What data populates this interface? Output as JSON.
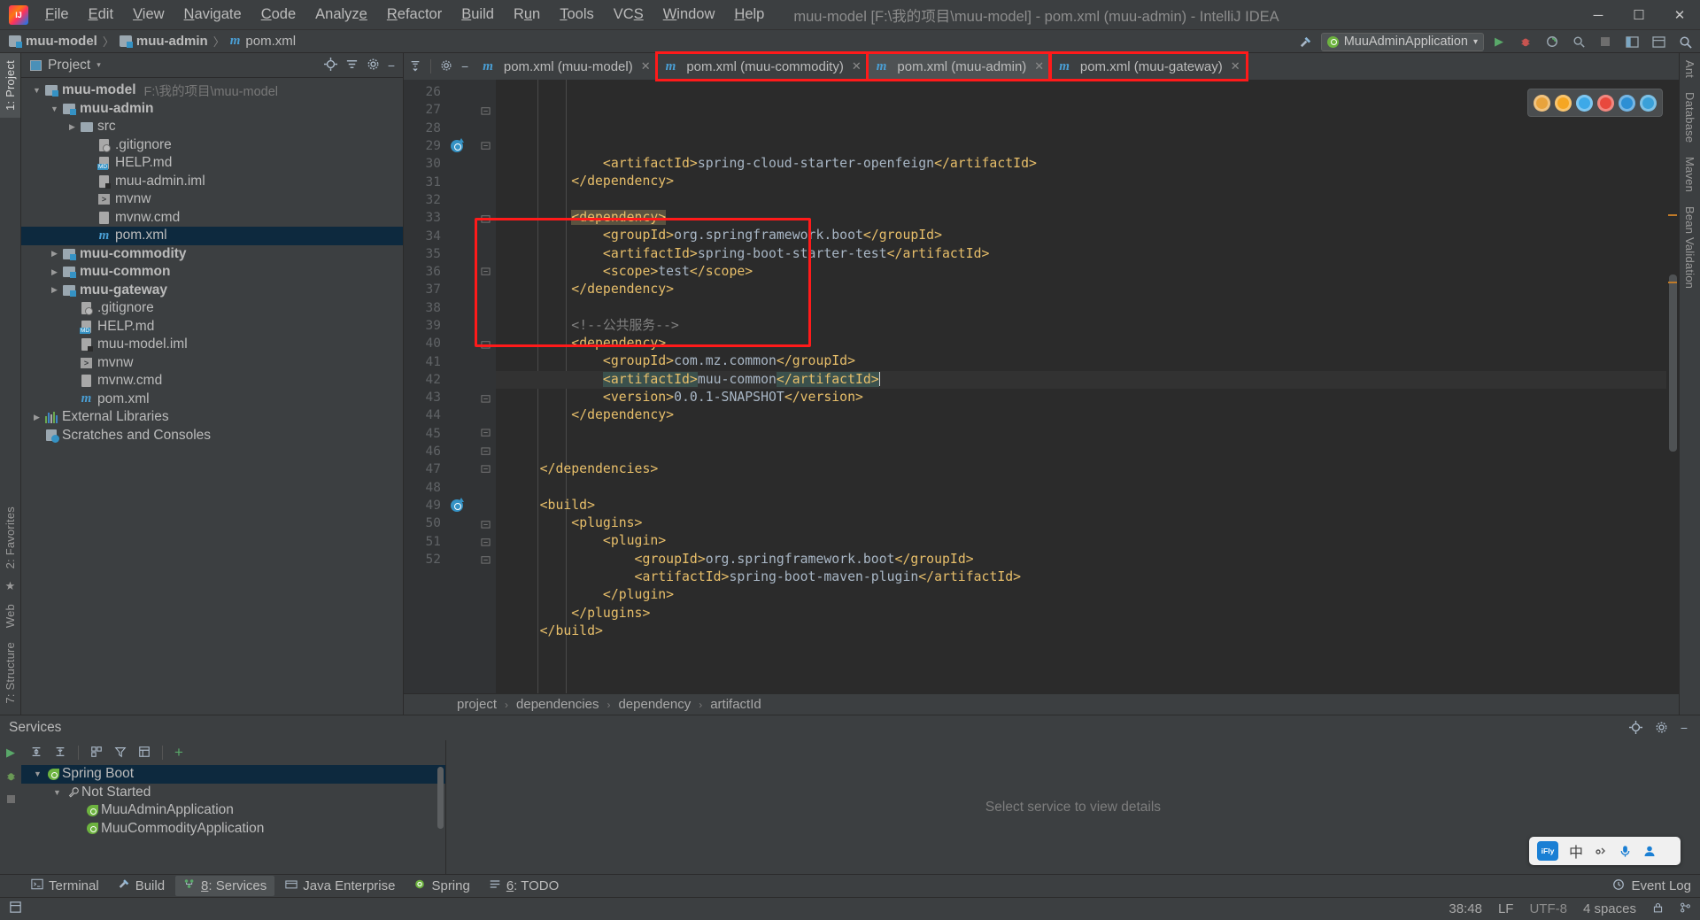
{
  "window": {
    "title": "muu-model [F:\\我的项目\\muu-model] - pom.xml (muu-admin) - IntelliJ IDEA",
    "minimize": "─",
    "maximize": "☐",
    "close": "✕"
  },
  "menubar": [
    {
      "label": "File"
    },
    {
      "label": "Edit"
    },
    {
      "label": "View"
    },
    {
      "label": "Navigate"
    },
    {
      "label": "Code"
    },
    {
      "label": "Analyze"
    },
    {
      "label": "Refactor"
    },
    {
      "label": "Build"
    },
    {
      "label": "Run"
    },
    {
      "label": "Tools"
    },
    {
      "label": "VCS"
    },
    {
      "label": "Window"
    },
    {
      "label": "Help"
    }
  ],
  "breadcrumb_nav": {
    "items": [
      "muu-model",
      "muu-admin",
      "pom.xml"
    ],
    "separator": "〉"
  },
  "run_config": {
    "name": "MuuAdminApplication",
    "dropdown_arrow": "▾",
    "run_icon": "play-icon",
    "debug_icon": "debug-icon",
    "coverage_icon": "run-with-coverage-icon",
    "profile_icon": "profiler-icon",
    "stop_icon": "stop-icon",
    "hammer_icon": "build-icon",
    "layout_icon": "layout-icon",
    "search_icon": "search-icon"
  },
  "project_panel": {
    "title": "Project",
    "dropdown_arrow": "▾",
    "locate_icon": "locate-file-icon",
    "collapse_icon": "collapse-all-icon",
    "settings_icon": "gear-icon",
    "hide_icon": "hide-panel-icon",
    "tree": [
      {
        "label": "muu-model",
        "hint": "F:\\我的项目\\muu-model",
        "indent": 0,
        "arrow": "open",
        "icon": "module",
        "bold": true,
        "selected": false
      },
      {
        "label": "muu-admin",
        "hint": "",
        "indent": 1,
        "arrow": "open",
        "icon": "module",
        "bold": true,
        "selected": false
      },
      {
        "label": "src",
        "hint": "",
        "indent": 2,
        "arrow": "closed",
        "icon": "folder",
        "bold": false,
        "selected": false
      },
      {
        "label": ".gitignore",
        "hint": "",
        "indent": 3,
        "arrow": "none",
        "icon": "git",
        "bold": false,
        "selected": false
      },
      {
        "label": "HELP.md",
        "hint": "",
        "indent": 3,
        "arrow": "none",
        "icon": "md",
        "bold": false,
        "selected": false
      },
      {
        "label": "muu-admin.iml",
        "hint": "",
        "indent": 3,
        "arrow": "none",
        "icon": "iml",
        "bold": false,
        "selected": false
      },
      {
        "label": "mvnw",
        "hint": "",
        "indent": 3,
        "arrow": "none",
        "icon": "sh",
        "bold": false,
        "selected": false
      },
      {
        "label": "mvnw.cmd",
        "hint": "",
        "indent": 3,
        "arrow": "none",
        "icon": "file",
        "bold": false,
        "selected": false
      },
      {
        "label": "pom.xml",
        "hint": "",
        "indent": 3,
        "arrow": "none",
        "icon": "maven",
        "bold": false,
        "selected": true
      },
      {
        "label": "muu-commodity",
        "hint": "",
        "indent": 1,
        "arrow": "closed",
        "icon": "module",
        "bold": true,
        "selected": false
      },
      {
        "label": "muu-common",
        "hint": "",
        "indent": 1,
        "arrow": "closed",
        "icon": "module",
        "bold": true,
        "selected": false
      },
      {
        "label": "muu-gateway",
        "hint": "",
        "indent": 1,
        "arrow": "closed",
        "icon": "module",
        "bold": true,
        "selected": false
      },
      {
        "label": ".gitignore",
        "hint": "",
        "indent": 2,
        "arrow": "none",
        "icon": "git",
        "bold": false,
        "selected": false
      },
      {
        "label": "HELP.md",
        "hint": "",
        "indent": 2,
        "arrow": "none",
        "icon": "md",
        "bold": false,
        "selected": false
      },
      {
        "label": "muu-model.iml",
        "hint": "",
        "indent": 2,
        "arrow": "none",
        "icon": "iml",
        "bold": false,
        "selected": false
      },
      {
        "label": "mvnw",
        "hint": "",
        "indent": 2,
        "arrow": "none",
        "icon": "sh",
        "bold": false,
        "selected": false
      },
      {
        "label": "mvnw.cmd",
        "hint": "",
        "indent": 2,
        "arrow": "none",
        "icon": "file",
        "bold": false,
        "selected": false
      },
      {
        "label": "pom.xml",
        "hint": "",
        "indent": 2,
        "arrow": "none",
        "icon": "maven",
        "bold": false,
        "selected": false
      },
      {
        "label": "External Libraries",
        "hint": "",
        "indent": 0,
        "arrow": "closed",
        "icon": "lib",
        "bold": false,
        "selected": false
      },
      {
        "label": "Scratches and Consoles",
        "hint": "",
        "indent": 0,
        "arrow": "none",
        "icon": "scratch",
        "bold": false,
        "selected": false
      }
    ]
  },
  "editor_tabs": [
    {
      "label": "pom.xml (muu-model)",
      "active": false,
      "highlighted": false,
      "close": "✕"
    },
    {
      "label": "pom.xml (muu-commodity)",
      "active": false,
      "highlighted": true,
      "close": "✕"
    },
    {
      "label": "pom.xml (muu-admin)",
      "active": true,
      "highlighted": true,
      "close": "✕"
    },
    {
      "label": "pom.xml (muu-gateway)",
      "active": false,
      "highlighted": true,
      "close": "✕"
    }
  ],
  "editor": {
    "first_line": 26,
    "caret_position": "38:48",
    "lines": [
      {
        "num": 26,
        "indent": 3,
        "segments": [
          {
            "t": "<artifactId>",
            "c": "tag"
          },
          {
            "t": "spring-cloud-starter-openfeign",
            "c": "txt"
          },
          {
            "t": "</artifactId>",
            "c": "tag"
          }
        ],
        "fold": "",
        "gutter_icon": ""
      },
      {
        "num": 27,
        "indent": 2,
        "segments": [
          {
            "t": "</dependency>",
            "c": "tag"
          }
        ],
        "fold": "end",
        "gutter_icon": ""
      },
      {
        "num": 28,
        "indent": 0,
        "segments": [],
        "fold": "",
        "gutter_icon": ""
      },
      {
        "num": 29,
        "indent": 2,
        "segments": [
          {
            "t": "<dependency>",
            "c": "tag hl-tag"
          }
        ],
        "fold": "start",
        "gutter_icon": "run"
      },
      {
        "num": 30,
        "indent": 3,
        "segments": [
          {
            "t": "<groupId>",
            "c": "tag"
          },
          {
            "t": "org.springframework.boot",
            "c": "txt"
          },
          {
            "t": "</groupId>",
            "c": "tag"
          }
        ],
        "fold": "",
        "gutter_icon": ""
      },
      {
        "num": 31,
        "indent": 3,
        "segments": [
          {
            "t": "<artifactId>",
            "c": "tag"
          },
          {
            "t": "spring-boot-starter-test",
            "c": "txt"
          },
          {
            "t": "</artifactId>",
            "c": "tag"
          }
        ],
        "fold": "",
        "gutter_icon": ""
      },
      {
        "num": 32,
        "indent": 3,
        "segments": [
          {
            "t": "<scope>",
            "c": "tag"
          },
          {
            "t": "test",
            "c": "txt"
          },
          {
            "t": "</scope>",
            "c": "tag"
          }
        ],
        "fold": "",
        "gutter_icon": ""
      },
      {
        "num": 33,
        "indent": 2,
        "segments": [
          {
            "t": "</dependency>",
            "c": "tag"
          }
        ],
        "fold": "end",
        "gutter_icon": ""
      },
      {
        "num": 34,
        "indent": 0,
        "segments": [],
        "fold": "",
        "gutter_icon": ""
      },
      {
        "num": 35,
        "indent": 2,
        "segments": [
          {
            "t": "<!--公共服务-->",
            "c": "cmt"
          }
        ],
        "fold": "",
        "gutter_icon": ""
      },
      {
        "num": 36,
        "indent": 2,
        "segments": [
          {
            "t": "<dependency>",
            "c": "tag"
          }
        ],
        "fold": "start",
        "gutter_icon": ""
      },
      {
        "num": 37,
        "indent": 3,
        "segments": [
          {
            "t": "<groupId>",
            "c": "tag"
          },
          {
            "t": "com.mz.common",
            "c": "txt"
          },
          {
            "t": "</groupId>",
            "c": "tag"
          }
        ],
        "fold": "",
        "gutter_icon": ""
      },
      {
        "num": 38,
        "indent": 3,
        "segments": [
          {
            "t": "<artifactId>",
            "c": "tag sel-green"
          },
          {
            "t": "muu-common",
            "c": "txt"
          },
          {
            "t": "</artifactId>",
            "c": "tag sel-green"
          }
        ],
        "fold": "",
        "gutter_icon": "",
        "current": true,
        "caret": true
      },
      {
        "num": 39,
        "indent": 3,
        "segments": [
          {
            "t": "<version>",
            "c": "tag"
          },
          {
            "t": "0.0.1-SNAPSHOT",
            "c": "txt"
          },
          {
            "t": "</version>",
            "c": "tag"
          }
        ],
        "fold": "",
        "gutter_icon": ""
      },
      {
        "num": 40,
        "indent": 2,
        "segments": [
          {
            "t": "</dependency>",
            "c": "tag"
          }
        ],
        "fold": "end",
        "gutter_icon": ""
      },
      {
        "num": 41,
        "indent": 0,
        "segments": [],
        "fold": "",
        "gutter_icon": ""
      },
      {
        "num": 42,
        "indent": 0,
        "segments": [],
        "fold": "",
        "gutter_icon": ""
      },
      {
        "num": 43,
        "indent": 1,
        "segments": [
          {
            "t": "</dependencies>",
            "c": "tag"
          }
        ],
        "fold": "end",
        "gutter_icon": ""
      },
      {
        "num": 44,
        "indent": 0,
        "segments": [],
        "fold": "",
        "gutter_icon": ""
      },
      {
        "num": 45,
        "indent": 1,
        "segments": [
          {
            "t": "<build>",
            "c": "tag"
          }
        ],
        "fold": "start",
        "gutter_icon": ""
      },
      {
        "num": 46,
        "indent": 2,
        "segments": [
          {
            "t": "<plugins>",
            "c": "tag"
          }
        ],
        "fold": "start",
        "gutter_icon": ""
      },
      {
        "num": 47,
        "indent": 3,
        "segments": [
          {
            "t": "<plugin>",
            "c": "tag"
          }
        ],
        "fold": "start",
        "gutter_icon": ""
      },
      {
        "num": 48,
        "indent": 4,
        "segments": [
          {
            "t": "<groupId>",
            "c": "tag"
          },
          {
            "t": "org.springframework.boot",
            "c": "txt"
          },
          {
            "t": "</groupId>",
            "c": "tag"
          }
        ],
        "fold": "",
        "gutter_icon": ""
      },
      {
        "num": 49,
        "indent": 4,
        "segments": [
          {
            "t": "<artifactId>",
            "c": "tag"
          },
          {
            "t": "spring-boot-maven-plugin",
            "c": "txt"
          },
          {
            "t": "</artifactId>",
            "c": "tag"
          }
        ],
        "fold": "",
        "gutter_icon": "run"
      },
      {
        "num": 50,
        "indent": 3,
        "segments": [
          {
            "t": "</plugin>",
            "c": "tag"
          }
        ],
        "fold": "end",
        "gutter_icon": ""
      },
      {
        "num": 51,
        "indent": 2,
        "segments": [
          {
            "t": "</plugins>",
            "c": "tag"
          }
        ],
        "fold": "end",
        "gutter_icon": ""
      },
      {
        "num": 52,
        "indent": 1,
        "segments": [
          {
            "t": "</build>",
            "c": "tag"
          }
        ],
        "fold": "end",
        "gutter_icon": ""
      }
    ]
  },
  "editor_breadcrumb": {
    "items": [
      "project",
      "dependencies",
      "dependency",
      "artifactId"
    ],
    "separator": "›"
  },
  "services": {
    "title": "Services",
    "settings_icon": "gear-icon",
    "help_icon": "help-icon",
    "hide_icon": "hide-panel-icon",
    "detail_placeholder": "Select service to view details",
    "toolbar": [
      {
        "name": "run-icon",
        "glyph": "▶"
      },
      {
        "name": "debug-icon",
        "glyph": "ὁE"
      },
      {
        "name": "stop-icon",
        "glyph": "■"
      }
    ],
    "buttons": [
      {
        "name": "expand-all-icon",
        "glyph": "⤓"
      },
      {
        "name": "collapse-all-icon",
        "glyph": "⤒"
      },
      {
        "name": "group-icon",
        "glyph": "▦"
      },
      {
        "name": "filter-icon",
        "glyph": "∇"
      },
      {
        "name": "view-options-icon",
        "glyph": "▣"
      },
      {
        "name": "add-service-icon",
        "glyph": "+"
      }
    ],
    "tree": [
      {
        "label": "Spring Boot",
        "indent": 0,
        "arrow": "open",
        "icon": "spring",
        "selected": true
      },
      {
        "label": "Not Started",
        "indent": 1,
        "arrow": "open",
        "icon": "wrench",
        "selected": false
      },
      {
        "label": "MuuAdminApplication",
        "indent": 2,
        "arrow": "none",
        "icon": "spring",
        "selected": false
      },
      {
        "label": "MuuCommodityApplication",
        "indent": 2,
        "arrow": "none",
        "icon": "spring",
        "selected": false
      }
    ]
  },
  "bottom_tabs": [
    {
      "label": "Terminal",
      "icon": "terminal-icon",
      "active": false
    },
    {
      "label": "Build",
      "icon": "build-icon",
      "active": false
    },
    {
      "label": "8: Services",
      "icon": "services-icon",
      "active": true
    },
    {
      "label": "Java Enterprise",
      "icon": "java-enterprise-icon",
      "active": false
    },
    {
      "label": "Spring",
      "icon": "spring-icon",
      "active": false
    },
    {
      "label": "6: TODO",
      "icon": "todo-icon",
      "active": false
    }
  ],
  "event_log": {
    "label": "Event Log",
    "icon": "event-log-icon"
  },
  "left_strip": [
    {
      "label": "1: Project",
      "active": true
    },
    {
      "label": "2: Favorites",
      "active": false
    },
    {
      "label": "Web",
      "active": false
    },
    {
      "label": "7: Structure",
      "active": false
    }
  ],
  "right_strip": [
    {
      "label": "Ant",
      "active": false
    },
    {
      "label": "Database",
      "active": false
    },
    {
      "label": "Maven",
      "active": false
    },
    {
      "label": "Bean Validation",
      "active": false
    }
  ],
  "status_bar": {
    "caret": "38:48",
    "line_separator": "LF",
    "encoding": "UTF-8",
    "indent": "4 spaces",
    "lock_icon": "lock-icon",
    "branch_icon": "git-branch-icon"
  },
  "ime_bar": {
    "brand": "iFly",
    "mode": "中",
    "punct_icon": "punctuation-icon",
    "mic_icon": "microphone-icon",
    "user_icon": "user-icon",
    "menu_icon": "menu-grid-icon"
  },
  "float_toolbar": [
    {
      "name": "chrome-browser-icon",
      "color": "#e8a33d"
    },
    {
      "name": "firefox-browser-icon",
      "color": "#f5a623"
    },
    {
      "name": "safari-browser-icon",
      "color": "#3da9e8"
    },
    {
      "name": "opera-browser-icon",
      "color": "#e8493d"
    },
    {
      "name": "edge-browser-icon",
      "color": "#2d8fd4"
    },
    {
      "name": "explorer-browser-icon",
      "color": "#3aa0d8"
    }
  ],
  "colors": {
    "accent_red": "#ff1a1a",
    "selection_blue": "#0d293e",
    "tag_orange": "#e8bf6a",
    "spring_green": "#6db33f"
  }
}
